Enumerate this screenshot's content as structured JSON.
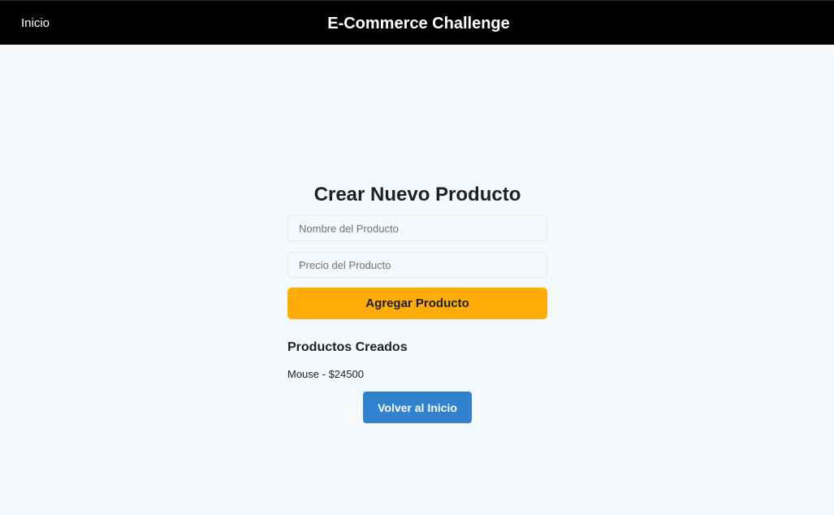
{
  "header": {
    "nav_home": "Inicio",
    "title": "E-Commerce Challenge"
  },
  "form": {
    "title": "Crear Nuevo Producto",
    "name_input": {
      "placeholder": "Nombre del Producto",
      "value": ""
    },
    "price_input": {
      "placeholder": "Precio del Producto",
      "value": ""
    },
    "add_button": "Agregar Producto"
  },
  "products": {
    "heading": "Productos Creados",
    "items": [
      {
        "label": "Mouse - $24500"
      }
    ]
  },
  "back_button": "Volver al Inicio",
  "colors": {
    "header_bg": "#000000",
    "page_bg": "#f6f9fc",
    "add_button": "#ffab08",
    "back_button": "#3182ce"
  }
}
